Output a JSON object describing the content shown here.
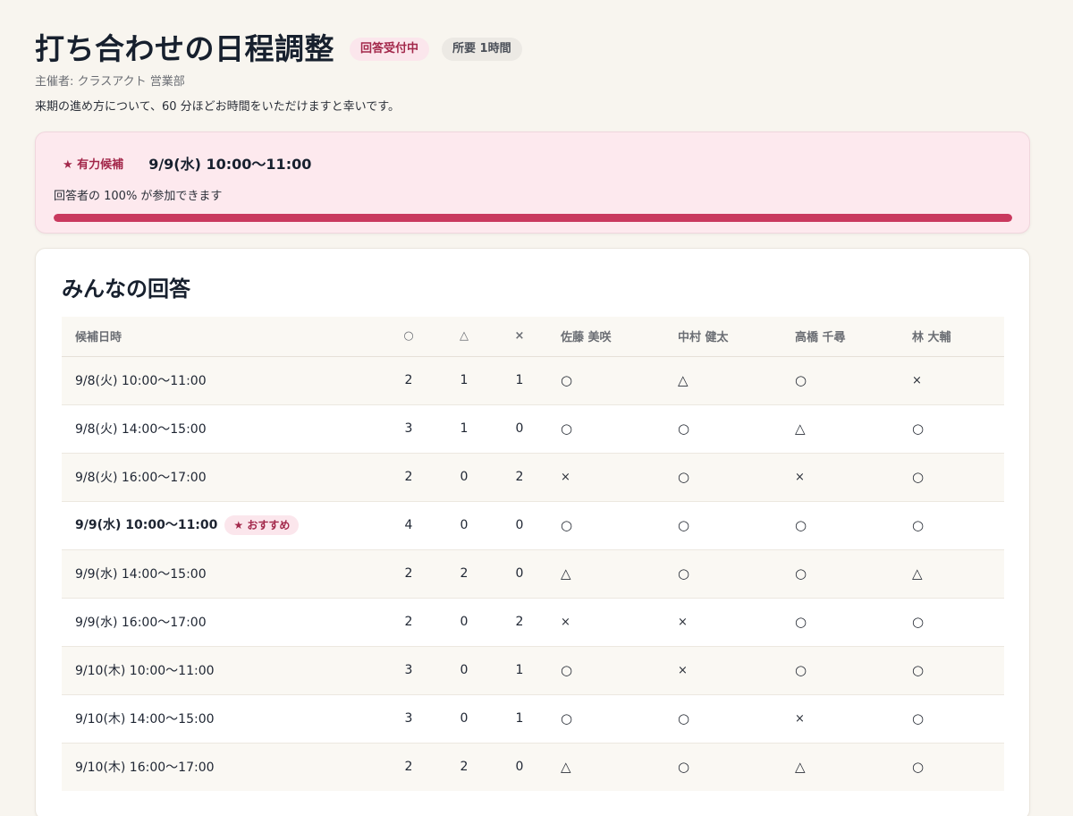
{
  "header": {
    "title": "打ち合わせの日程調整",
    "status_badge": "回答受付中",
    "duration_badge": "所要 1時間",
    "organizer": "主催者: クラスアクト 営業部",
    "description": "来期の進め方について、60 分ほどお時間をいただけますと幸いです。"
  },
  "highlight": {
    "tag": "★ 有力候補",
    "time": "9/9(水) 10:00〜11:00",
    "text": "回答者の 100% が参加できます",
    "progress_percent": 100,
    "accent_color": "#c9395e"
  },
  "responses": {
    "title": "みんなの回答",
    "columns": [
      "候補日時",
      "○",
      "△",
      "×",
      "佐藤 美咲",
      "中村 健太",
      "高橋 千尋",
      "林 大輔"
    ],
    "recommended_label": "★ おすすめ",
    "rows": [
      {
        "date": "9/8(火) 10:00〜11:00",
        "ok": "2",
        "maybe": "1",
        "ng": "1",
        "answers": [
          "○",
          "△",
          "○",
          "×"
        ],
        "recommended": false
      },
      {
        "date": "9/8(火) 14:00〜15:00",
        "ok": "3",
        "maybe": "1",
        "ng": "0",
        "answers": [
          "○",
          "○",
          "△",
          "○"
        ],
        "recommended": false
      },
      {
        "date": "9/8(火) 16:00〜17:00",
        "ok": "2",
        "maybe": "0",
        "ng": "2",
        "answers": [
          "×",
          "○",
          "×",
          "○"
        ],
        "recommended": false
      },
      {
        "date": "9/9(水) 10:00〜11:00",
        "ok": "4",
        "maybe": "0",
        "ng": "0",
        "answers": [
          "○",
          "○",
          "○",
          "○"
        ],
        "recommended": true
      },
      {
        "date": "9/9(水) 14:00〜15:00",
        "ok": "2",
        "maybe": "2",
        "ng": "0",
        "answers": [
          "△",
          "○",
          "○",
          "△"
        ],
        "recommended": false
      },
      {
        "date": "9/9(水) 16:00〜17:00",
        "ok": "2",
        "maybe": "0",
        "ng": "2",
        "answers": [
          "×",
          "×",
          "○",
          "○"
        ],
        "recommended": false
      },
      {
        "date": "9/10(木) 10:00〜11:00",
        "ok": "3",
        "maybe": "0",
        "ng": "1",
        "answers": [
          "○",
          "×",
          "○",
          "○"
        ],
        "recommended": false
      },
      {
        "date": "9/10(木) 14:00〜15:00",
        "ok": "3",
        "maybe": "0",
        "ng": "1",
        "answers": [
          "○",
          "○",
          "×",
          "○"
        ],
        "recommended": false
      },
      {
        "date": "9/10(木) 16:00〜17:00",
        "ok": "2",
        "maybe": "2",
        "ng": "0",
        "answers": [
          "△",
          "○",
          "△",
          "○"
        ],
        "recommended": false
      }
    ]
  }
}
